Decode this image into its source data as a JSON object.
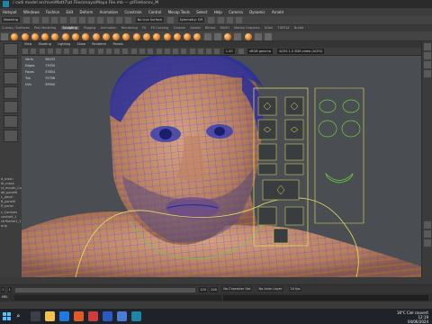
{
  "window": {
    "title": "/ cadi model archive\\Matt7\\at Files\\maya\\Maya File.mb — ptFiletionsv_M"
  },
  "menubar": {
    "items": [
      "Hotspot",
      "Windows",
      "Fashion",
      "Edit",
      "Deform",
      "Animation",
      "Constrain",
      "Control",
      "Mocap Tools",
      "Select",
      "Help",
      "Camera",
      "Dynamic",
      "Arnold",
      "Help"
    ]
  },
  "statusline": {
    "mode": "Modeling",
    "surface": "No Live Surface",
    "symmetry": "Symmetry: Off",
    "sym_label": "Symmetry: Off"
  },
  "shelf": {
    "tabs": [
      "Curves / Surfaces",
      "Poly Modeling",
      "Sculpting",
      "Rigging",
      "Animation",
      "Rendering",
      "FX",
      "FX Caching",
      "Custom",
      "Arnold",
      "Bifrost",
      "MASH",
      "Motion Graphics",
      "XGen",
      "TURTLE",
      "Bullet"
    ],
    "active_tab": "Sculpting"
  },
  "viewport": {
    "menu": [
      "View",
      "Shading",
      "Lighting",
      "Show",
      "Renderer",
      "Panels"
    ],
    "field_value": "1.00",
    "gamma": "sRGB gamma",
    "color_mode": "ACES 1.0 SDR-video (ACES)"
  },
  "hud_stats": [
    {
      "label": "Verts",
      "value": "36033"
    },
    {
      "label": "Edges",
      "value": "73930"
    },
    {
      "label": "Faces",
      "value": "37854"
    },
    {
      "label": "Tris",
      "value": "75708"
    },
    {
      "label": "UVs",
      "value": "39900"
    }
  ],
  "outliner": {
    "items": [
      "d_mesh",
      "fb_mesh",
      "ct_mouth_Corner",
      "ab_paneltl",
      "L_panel",
      "B_paneltl",
      "R_panel",
      "",
      "",
      "c_Controls",
      "controlt_1",
      "ctrlframe1_1",
      "orig"
    ]
  },
  "range": {
    "start": "1",
    "inner_start": "1",
    "inner_end": "120",
    "end": "200",
    "character_set": "No Character Set",
    "anim_layer": "No Anim Layer",
    "fps": "24 fps"
  },
  "cmdline": {
    "label": "MEL"
  },
  "taskbar": {
    "weather": "18°C Ciel couvert",
    "time": "12:19",
    "date": "04/06/2024"
  },
  "colors": {
    "wire_blue": "#2a3cff",
    "wire_orange": "#e0822a",
    "skin": "#c99074",
    "panel_yellow": "#e8e060",
    "ctrl_green": "#6ad040",
    "accent": "#4cc2ff"
  }
}
